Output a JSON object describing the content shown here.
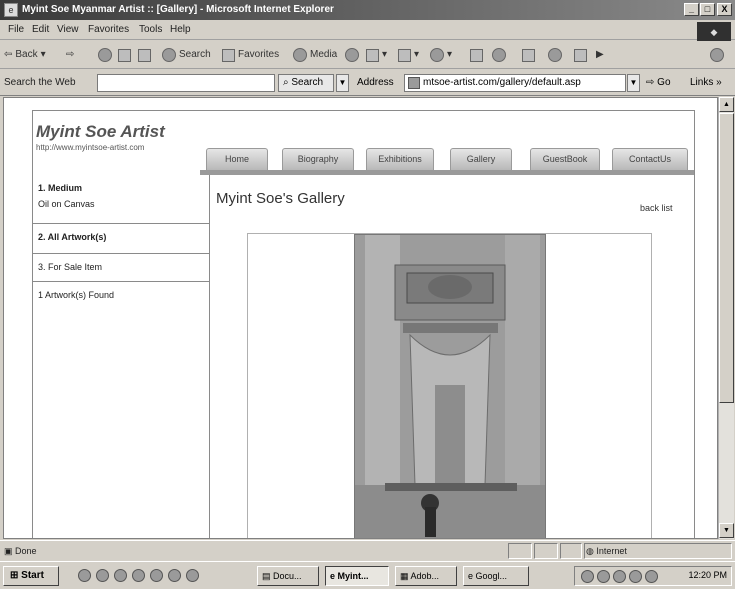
{
  "window": {
    "title": "Myint Soe Myanmar Artist :: [Gallery] - Microsoft Internet Explorer",
    "buttons": {
      "minimize": "_",
      "maximize": "□",
      "close": "X"
    }
  },
  "menu": [
    "File",
    "Edit",
    "View",
    "Favorites",
    "Tools",
    "Help"
  ],
  "toolbar": {
    "back": "Back",
    "search": "Search",
    "favorites": "Favorites",
    "media": "Media"
  },
  "addressbar": {
    "search_web_label": "Search the Web",
    "search_button": "Search",
    "address_label": "Address",
    "url": "mtsoe-artist.com/gallery/default.asp",
    "go": "Go",
    "links": "Links"
  },
  "site": {
    "title": "Myint Soe Artist",
    "url": "http://www.myintsoe-artist.com",
    "nav": [
      "Home",
      "Biography",
      "Exhibitions",
      "Gallery",
      "GuestBook",
      "ContactUs"
    ]
  },
  "sidebar": {
    "medium_heading": "1. Medium",
    "medium_value": "Oil on Canvas",
    "all_artwork": "2. All Artwork(s)",
    "for_sale": "3. For Sale Item",
    "found": "1 Artwork(s) Found"
  },
  "gallery": {
    "title": "Myint Soe's Gallery",
    "back_link": "back list"
  },
  "status": {
    "text": "Done",
    "zone": "Internet"
  },
  "taskbar": {
    "start": "Start",
    "tasks": [
      {
        "label": "Docu...",
        "active": false
      },
      {
        "label": "Myint...",
        "active": true
      },
      {
        "label": "Adob...",
        "active": false
      },
      {
        "label": "Googl...",
        "active": false
      }
    ],
    "clock": "12:20 PM"
  }
}
